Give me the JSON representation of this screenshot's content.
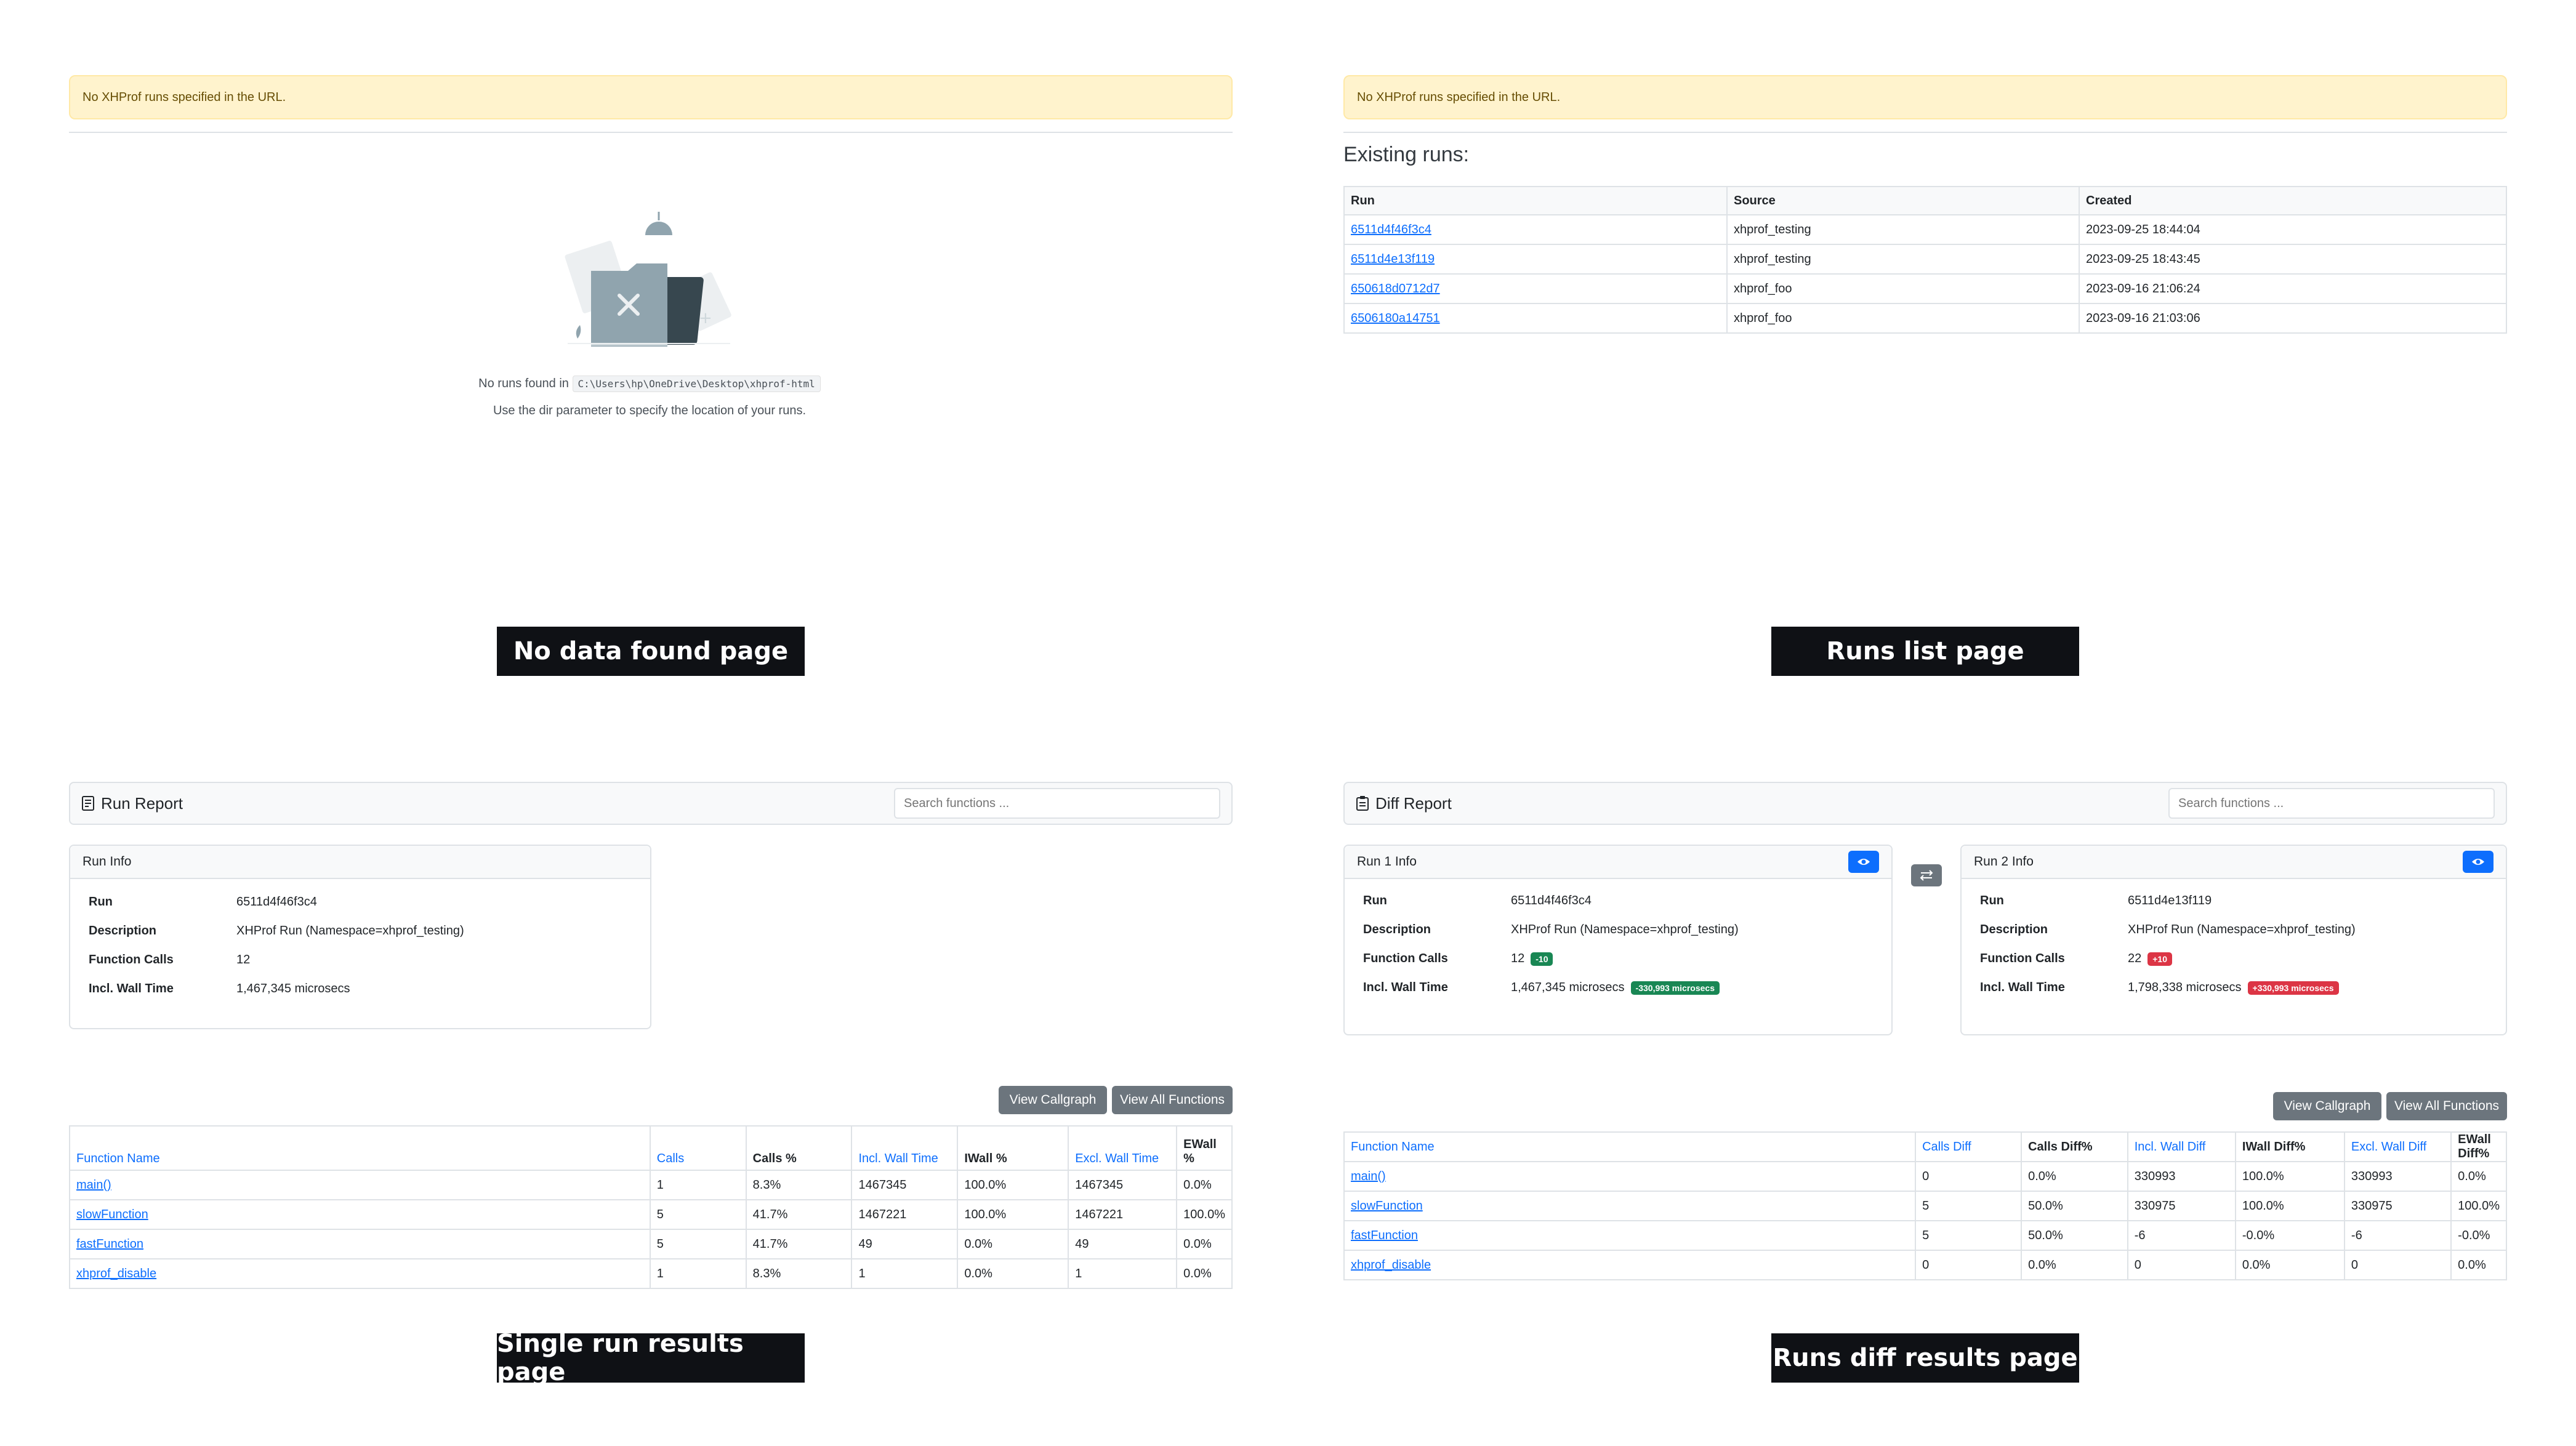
{
  "colors": {
    "alert_bg": "#fff3cd",
    "link": "#0d6efd",
    "caption_bg": "#0f1115",
    "badge_green": "#198754",
    "badge_red": "#dc3545",
    "button_gray": "#6c757d"
  },
  "no_data": {
    "alert": "No XHProf runs specified in the URL.",
    "found_prefix": "No runs found in",
    "path": "C:\\Users\\hp\\OneDrive\\Desktop\\xhprof-html",
    "hint": "Use the dir parameter to specify the location of your runs.",
    "caption": "No data found page",
    "illustration_icon": "empty-folder-illustration"
  },
  "runs_list": {
    "alert": "No XHProf runs specified in the URL.",
    "heading": "Existing runs:",
    "columns": [
      "Run",
      "Source",
      "Created"
    ],
    "rows": [
      [
        "6511d4f46f3c4",
        "xhprof_testing",
        "2023-09-25 18:44:04"
      ],
      [
        "6511d4e13f119",
        "xhprof_testing",
        "2023-09-25 18:43:45"
      ],
      [
        "650618d0712d7",
        "xhprof_foo",
        "2023-09-16 21:06:24"
      ],
      [
        "6506180a14751",
        "xhprof_foo",
        "2023-09-16 21:03:06"
      ]
    ],
    "caption": "Runs list page"
  },
  "single_run": {
    "title": "Run Report",
    "title_icon": "report-icon",
    "search_placeholder": "Search functions ...",
    "info_title": "Run Info",
    "info": [
      {
        "k": "Run",
        "v": "6511d4f46f3c4"
      },
      {
        "k": "Description",
        "v": "XHProf Run (Namespace=xhprof_testing)"
      },
      {
        "k": "Function Calls",
        "v": "12"
      },
      {
        "k": "Incl. Wall Time",
        "v": "1,467,345 microsecs"
      }
    ],
    "btn_callgraph": "View Callgraph",
    "btn_all": "View All Functions",
    "columns": [
      "Function Name",
      "Calls",
      "Calls %",
      "Incl. Wall Time",
      "IWall %",
      "Excl. Wall Time",
      "EWall %"
    ],
    "rows": [
      [
        "main()",
        "1",
        "8.3%",
        "1467345",
        "100.0%",
        "1467345",
        "0.0%"
      ],
      [
        "slowFunction",
        "5",
        "41.7%",
        "1467221",
        "100.0%",
        "1467221",
        "100.0%"
      ],
      [
        "fastFunction",
        "5",
        "41.7%",
        "49",
        "0.0%",
        "49",
        "0.0%"
      ],
      [
        "xhprof_disable",
        "1",
        "8.3%",
        "1",
        "0.0%",
        "1",
        "0.0%"
      ]
    ],
    "caption": "Single run results page"
  },
  "diff": {
    "title": "Diff Report",
    "title_icon": "diff-report-icon",
    "search_placeholder": "Search functions ...",
    "run1": {
      "title": "Run 1 Info",
      "run": "6511d4f46f3c4",
      "description": "XHProf Run (Namespace=xhprof_testing)",
      "calls": "12",
      "calls_badge": "-10",
      "wall": "1,467,345 microsecs",
      "wall_badge": "-330,993 microsecs"
    },
    "run2": {
      "title": "Run 2 Info",
      "run": "6511d4e13f119",
      "description": "XHProf Run (Namespace=xhprof_testing)",
      "calls": "22",
      "calls_badge": "+10",
      "wall": "1,798,338 microsecs",
      "wall_badge": "+330,993 microsecs"
    },
    "labels": {
      "run": "Run",
      "description": "Description",
      "calls": "Function Calls",
      "wall": "Incl. Wall Time"
    },
    "btn_callgraph": "View Callgraph",
    "btn_all": "View All Functions",
    "columns": [
      "Function Name",
      "Calls Diff",
      "Calls Diff%",
      "Incl. Wall Diff",
      "IWall Diff%",
      "Excl. Wall Diff",
      "EWall Diff%"
    ],
    "rows": [
      [
        "main()",
        "0",
        "0.0%",
        "330993",
        "100.0%",
        "330993",
        "0.0%"
      ],
      [
        "slowFunction",
        "5",
        "50.0%",
        "330975",
        "100.0%",
        "330975",
        "100.0%"
      ],
      [
        "fastFunction",
        "5",
        "50.0%",
        "-6",
        "-0.0%",
        "-6",
        "-0.0%"
      ],
      [
        "xhprof_disable",
        "0",
        "0.0%",
        "0",
        "0.0%",
        "0",
        "0.0%"
      ]
    ],
    "caption": "Runs diff results page"
  }
}
